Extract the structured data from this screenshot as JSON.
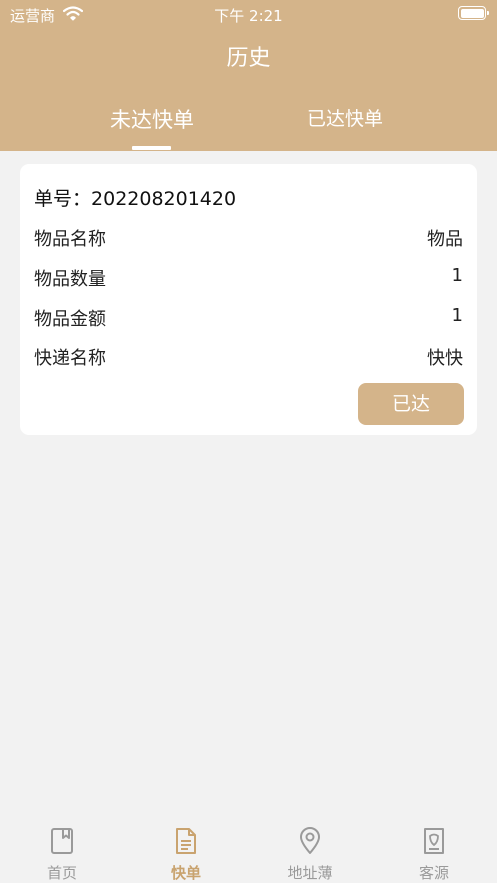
{
  "status_bar": {
    "carrier": "运营商",
    "time": "下午 2:21"
  },
  "header": {
    "title": "历史"
  },
  "tabs": [
    {
      "label": "未达快单",
      "active": true
    },
    {
      "label": "已达快单",
      "active": false
    }
  ],
  "order": {
    "number_label": "单号：",
    "number": "202208201420",
    "rows": [
      {
        "label": "物品名称",
        "value": "物品"
      },
      {
        "label": "物品数量",
        "value": "1"
      },
      {
        "label": "物品金额",
        "value": "1"
      },
      {
        "label": "快递名称",
        "value": "快快"
      }
    ],
    "action_label": "已达"
  },
  "tabbar": {
    "items": [
      {
        "label": "首页",
        "icon": "book-icon",
        "active": false
      },
      {
        "label": "快单",
        "icon": "document-icon",
        "active": true
      },
      {
        "label": "地址薄",
        "icon": "location-pin-icon",
        "active": false
      },
      {
        "label": "客源",
        "icon": "customer-card-icon",
        "active": false
      }
    ]
  },
  "colors": {
    "accent": "#d4b48a",
    "active_tab_text": "#c9a36f",
    "inactive_tab_text": "#9a9a9a",
    "background": "#f2f2f2"
  }
}
